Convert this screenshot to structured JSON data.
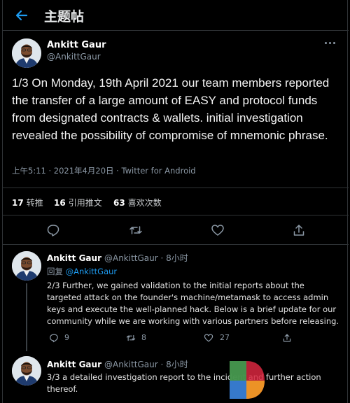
{
  "header": {
    "title": "主题帖"
  },
  "main_tweet": {
    "author_name": "Ankitt Gaur",
    "author_handle": "@AnkittGaur",
    "text": "1/3 On Monday, 19th April 2021 our team members reported the transfer of a large amount of EASY and protocol funds from designated contracts & wallets. initial investigation revealed the possibility of compromise of mnemonic phrase.",
    "meta": "上午5:11 · 2021年4月20日 · Twitter for Android",
    "stats": [
      {
        "count": "17",
        "label": "转推"
      },
      {
        "count": "16",
        "label": "引用推文"
      },
      {
        "count": "63",
        "label": "喜欢次数"
      }
    ],
    "actions": [
      "reply-icon",
      "retweet-icon",
      "like-icon",
      "share-icon"
    ]
  },
  "replies": [
    {
      "author_name": "Ankitt Gaur",
      "author_handle": "@AnkittGaur",
      "separator": "·",
      "time": "8小时",
      "replying_label": "回复",
      "replying_to": "@AnkittGaur",
      "text": "2/3 Further, we gained validation to the initial reports about the targeted attack on the founder's machine/metamask to access admin keys and execute the well-planned hack. Below is a brief update for our community while we are working with various partners before releasing.",
      "reply_count": "9",
      "retweet_count": "8",
      "like_count": "27"
    },
    {
      "author_name": "Ankitt Gaur",
      "author_handle": "@AnkittGaur",
      "separator": "·",
      "time": "8小时",
      "text": "3/3 a detailed investigation report to the incident and further action thereof."
    }
  ],
  "colors": {
    "accent": "#1d9bf0",
    "background": "#000000",
    "muted": "#8b98a5"
  }
}
